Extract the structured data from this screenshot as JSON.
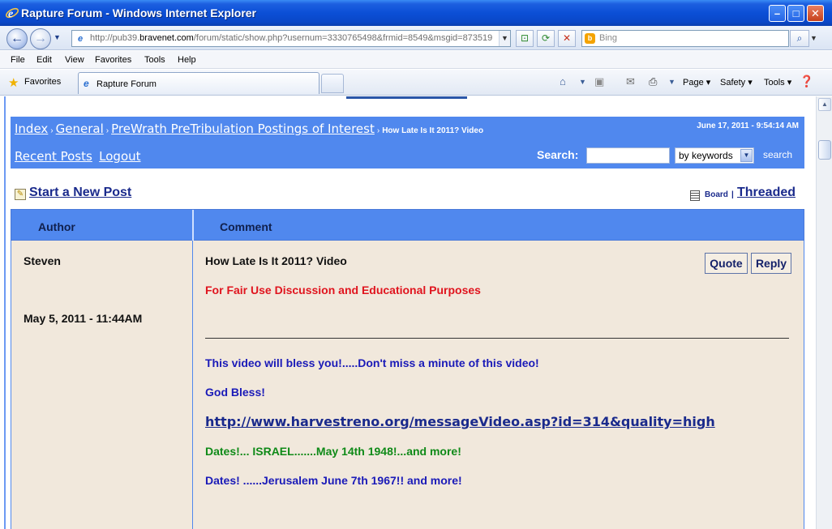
{
  "window": {
    "title": "Rapture Forum - Windows Internet Explorer",
    "minimize": "–",
    "maximize": "□",
    "close": "✕"
  },
  "addressbar": {
    "url_prefix": "http://pub39.",
    "url_domain": "bravenet.com",
    "url_rest": "/forum/static/show.php?usernum=3330765498&frmid=8549&msgid=873519",
    "search_placeholder": "Bing"
  },
  "menu": [
    "File",
    "Edit",
    "View",
    "Favorites",
    "Tools",
    "Help"
  ],
  "favorites": {
    "label": "Favorites",
    "tab_title": "Rapture Forum"
  },
  "commandbar": {
    "page": "Page",
    "safety": "Safety",
    "tools": "Tools"
  },
  "breadcrumb": {
    "index": "Index",
    "general": "General",
    "category": "PreWrath PreTribulation Postings of Interest",
    "current": "How Late Is It 2011? Video",
    "separator": "›"
  },
  "timestamp": "June 17, 2011 - 9:54:14 AM",
  "sublinks": {
    "recent": "Recent Posts",
    "logout": "Logout"
  },
  "search": {
    "label": "Search:",
    "mode": "by keywords",
    "button": "search"
  },
  "actions": {
    "new_post": "Start a New Post",
    "board": "Board",
    "pipe": "|",
    "threaded": "Threaded"
  },
  "table": {
    "author_header": "Author",
    "comment_header": "Comment"
  },
  "post": {
    "author": "Steven",
    "date": "May 5, 2011 - 11:44AM",
    "title": "How Late Is It 2011? Video",
    "quote": "Quote",
    "reply": "Reply",
    "fair_use": "For Fair Use Discussion and Educational Purposes",
    "line1": "This video will bless you!.....Don't miss a minute of this video!",
    "line2": "God Bless!",
    "link": "http://www.harvestreno.org/messageVideo.asp?id=314&quality=high",
    "line3": "Dates!... ISRAEL.......May 14th 1948!...and more!",
    "line4": "Dates! ......Jerusalem June 7th 1967!! and more!"
  }
}
